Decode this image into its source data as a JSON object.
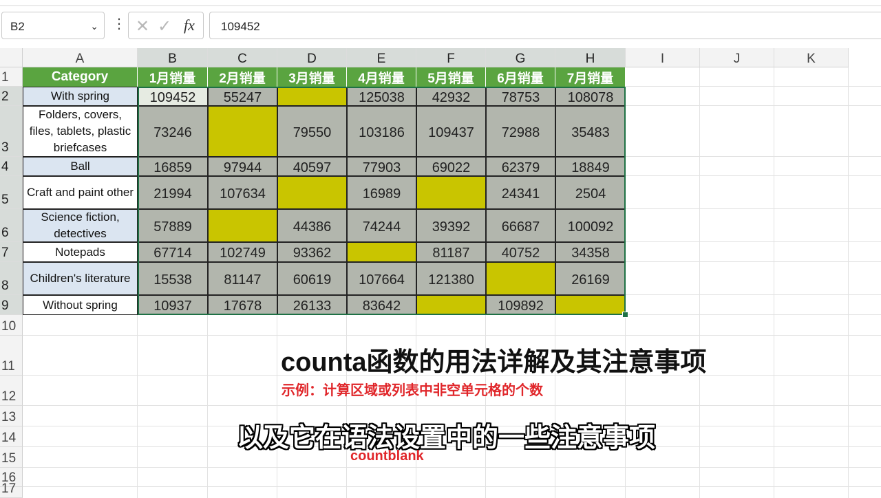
{
  "formula_bar": {
    "cell_ref": "B2",
    "formula_value": "109452"
  },
  "columns": [
    "A",
    "B",
    "C",
    "D",
    "E",
    "F",
    "G",
    "H",
    "I",
    "J",
    "K"
  ],
  "rows": [
    "1",
    "2",
    "3",
    "4",
    "5",
    "6",
    "7",
    "8",
    "9",
    "10",
    "11",
    "12",
    "13",
    "14",
    "15",
    "16",
    "17"
  ],
  "table": {
    "headers": [
      "Category",
      "1月销量",
      "2月销量",
      "3月销量",
      "4月销量",
      "5月销量",
      "6月销量",
      "7月销量"
    ],
    "categories": [
      "With spring",
      "Folders, covers, files, tablets, plastic briefcases",
      "Ball",
      "Craft and paint other",
      "Science fiction, detectives",
      "Notepads",
      "Children's literature",
      "Without spring"
    ],
    "values": [
      [
        "109452",
        "55247",
        "",
        "125038",
        "42932",
        "78753",
        "108078"
      ],
      [
        "73246",
        "",
        "79550",
        "103186",
        "109437",
        "72988",
        "35483"
      ],
      [
        "16859",
        "97944",
        "40597",
        "77903",
        "69022",
        "62379",
        "18849"
      ],
      [
        "21994",
        "107634",
        "",
        "16989",
        "",
        "24341",
        "2504"
      ],
      [
        "57889",
        "",
        "44386",
        "74244",
        "39392",
        "66687",
        "100092"
      ],
      [
        "67714",
        "102749",
        "93362",
        "",
        "81187",
        "40752",
        "34358"
      ],
      [
        "15538",
        "81147",
        "60619",
        "107664",
        "121380",
        "",
        "26169"
      ],
      [
        "10937",
        "17678",
        "26133",
        "83642",
        "",
        "109892",
        ""
      ]
    ]
  },
  "overlay": {
    "title": "counta函数的用法详解及其注意事项",
    "example": "示例：计算区域或列表中非空单元格的个数",
    "subtitle": "以及它在语法设置中的一些注意事项",
    "keyword": "countblank"
  },
  "colors": {
    "header_green": "#5aa440",
    "blank_yellow": "#c9c500",
    "value_gray": "#b2b6ad",
    "category_blue": "#dbe5f1",
    "accent_red": "#e0262a",
    "selection_green": "#1e7145"
  }
}
